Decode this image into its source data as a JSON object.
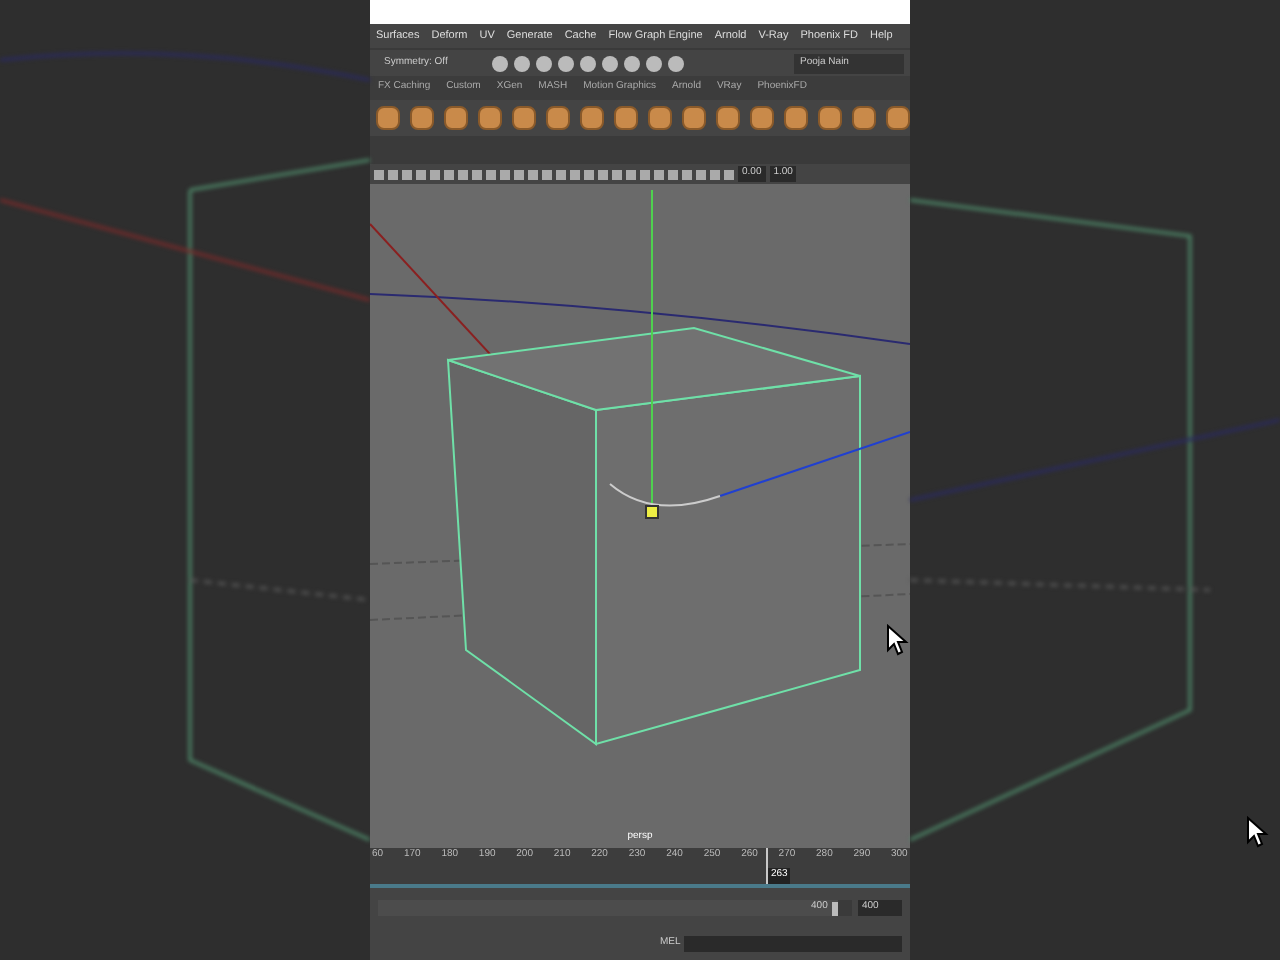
{
  "menu_bar": {
    "items": [
      "Surfaces",
      "Deform",
      "UV",
      "Generate",
      "Cache",
      "Flow Graph Engine",
      "Arnold",
      "V-Ray",
      "Phoenix FD",
      "Help"
    ]
  },
  "status_line": {
    "symmetry": "Symmetry: Off",
    "workspace": "Pooja Nain"
  },
  "shelf_tabs": [
    "FX Caching",
    "Custom",
    "XGen",
    "MASH",
    "Motion Graphics",
    "Arnold",
    "VRay",
    "PhoenixFD"
  ],
  "viewport_toolbar": {
    "exposure": "0.00",
    "gamma": "1.00"
  },
  "viewport": {
    "camera": "persp"
  },
  "timeline": {
    "ticks": [
      "60",
      "170",
      "180",
      "190",
      "200",
      "210",
      "220",
      "230",
      "240",
      "250",
      "260",
      "270",
      "280",
      "290",
      "300"
    ],
    "current_frame": "263",
    "level": 0.735
  },
  "range_slider": {
    "end": "400",
    "max": "400",
    "level": 0.97
  },
  "command_line": {
    "language": "MEL"
  }
}
